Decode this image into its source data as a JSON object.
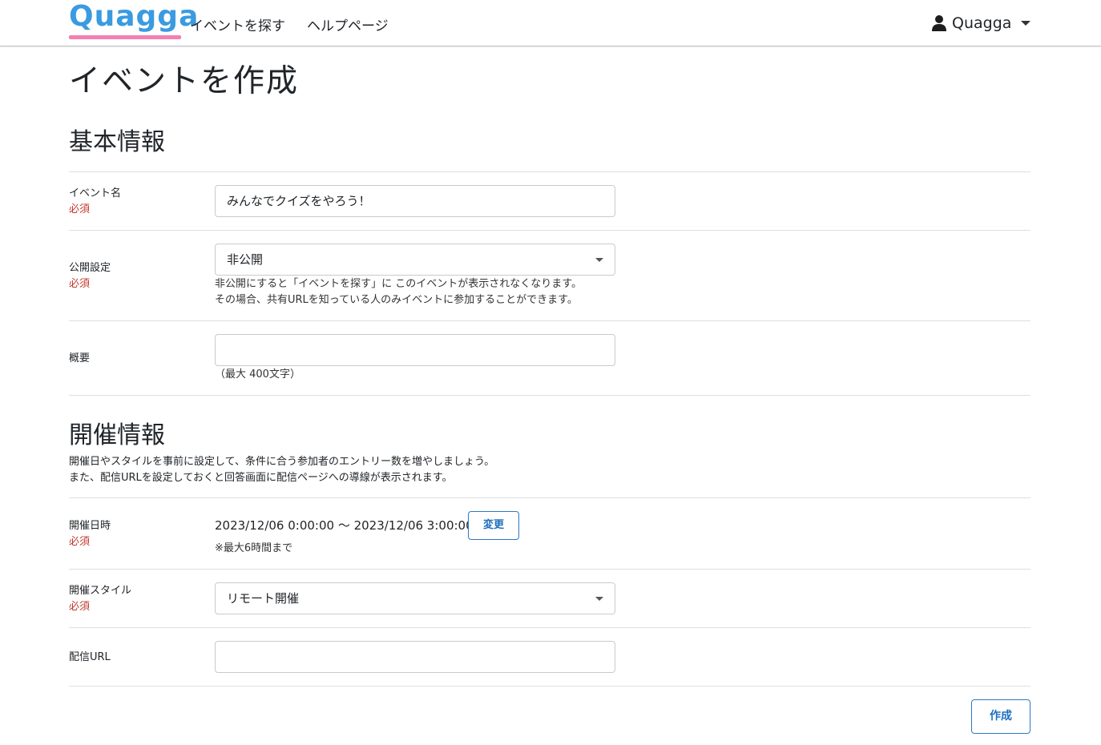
{
  "navbar": {
    "logo_text": "Quagga",
    "nav_links": [
      "イベントを探す",
      "ヘルプページ"
    ],
    "user_name": "Quagga",
    "user_icon": "user-icon"
  },
  "page_title": "イベントを作成",
  "basic_section": {
    "title": "基本情報",
    "required_text": "必須",
    "event_name": {
      "label": "イベント名",
      "value": "みんなでクイズをやろう！"
    },
    "visibility": {
      "label": "公開設定",
      "selected": "非公開",
      "help_lines": [
        "非公開にすると「イベントを探す」に このイベントが表示されなくなります。",
        "その場合、共有URLを知っている人のみイベントに参加することができます。"
      ]
    },
    "summary": {
      "label": "概要",
      "value": "",
      "help": "（最大 400文字）"
    }
  },
  "event_section": {
    "title": "開催情報",
    "desc_lines": [
      "開催日やスタイルを事前に設定して、条件に合う参加者のエントリー数を増やしましょう。",
      "また、配信URLを設定しておくと回答画面に配信ページへの導線が表示されます。"
    ],
    "datetime": {
      "label": "開催日時",
      "value": "2023/12/06 0:00:00 ～ 2023/12/06 3:00:00",
      "change_button": "変更",
      "help": "※最大6時間まで"
    },
    "style": {
      "label": "開催スタイル",
      "selected": "リモート開催"
    },
    "stream_url": {
      "label": "配信URL",
      "value": ""
    }
  },
  "create_button": "作成"
}
